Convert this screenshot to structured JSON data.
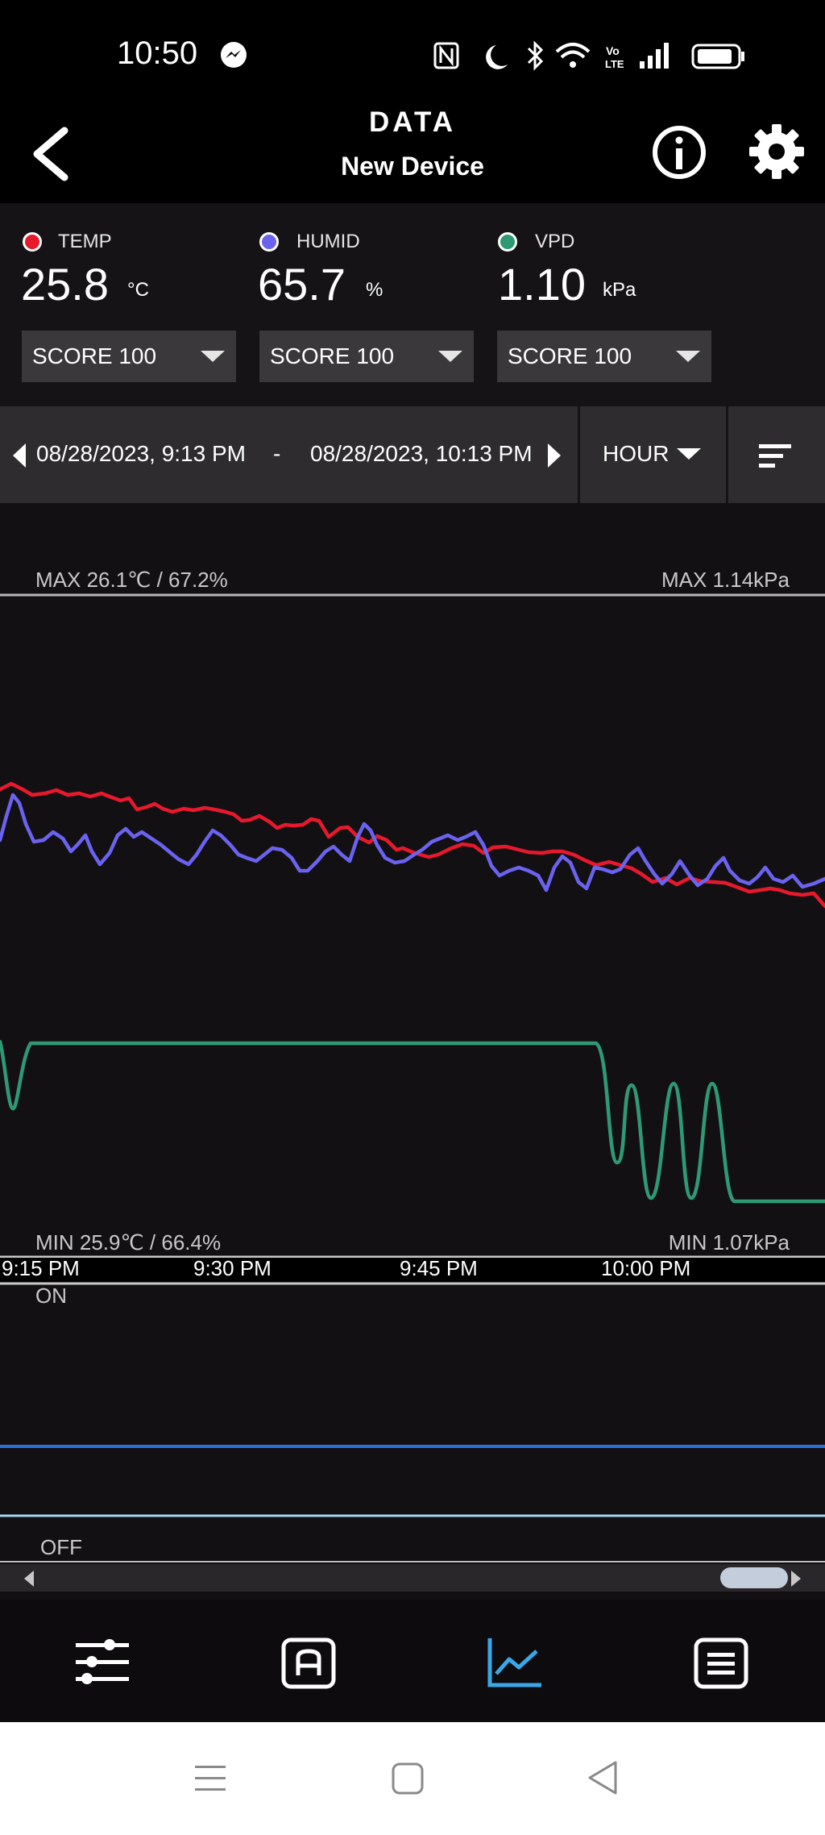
{
  "status_bar": {
    "time": "10:50"
  },
  "header": {
    "title": "DATA",
    "subtitle": "New Device"
  },
  "readings": [
    {
      "label": "TEMP",
      "value": "25.8",
      "unit": "°C",
      "color": "#e8192c",
      "score": "SCORE 100"
    },
    {
      "label": "HUMID",
      "value": "65.7",
      "unit": "%",
      "color": "#6a63f0",
      "score": "SCORE 100"
    },
    {
      "label": "VPD",
      "value": "1.10",
      "unit": "kPa",
      "color": "#2e9a73",
      "score": "SCORE 100"
    }
  ],
  "date_range": {
    "start": "08/28/2023, 9:13 PM",
    "separator": "-",
    "end": "08/28/2023, 10:13 PM",
    "interval": "HOUR"
  },
  "chart_labels": {
    "max_left": "MAX 26.1℃ / 67.2%",
    "max_right": "MAX 1.14kPa",
    "min_left": "MIN 25.9℃ / 66.4%",
    "min_right": "MIN 1.07kPa",
    "on": "ON",
    "off": "OFF"
  },
  "chart_data": {
    "type": "line",
    "x": [
      "9:15 PM",
      "9:30 PM",
      "9:45 PM",
      "10:00 PM"
    ],
    "series": [
      {
        "name": "TEMP",
        "color": "#e8192c"
      },
      {
        "name": "HUMID",
        "color": "#6a63f0"
      },
      {
        "name": "VPD",
        "color": "#2e9a73"
      }
    ]
  },
  "bottom_nav": [
    {
      "name": "sliders-icon",
      "active": false
    },
    {
      "name": "auto-mode-icon",
      "active": false
    },
    {
      "name": "chart-icon",
      "active": true
    },
    {
      "name": "list-icon",
      "active": false
    }
  ],
  "colors": {
    "accent": "#3aa7e8",
    "background": "#131014"
  }
}
